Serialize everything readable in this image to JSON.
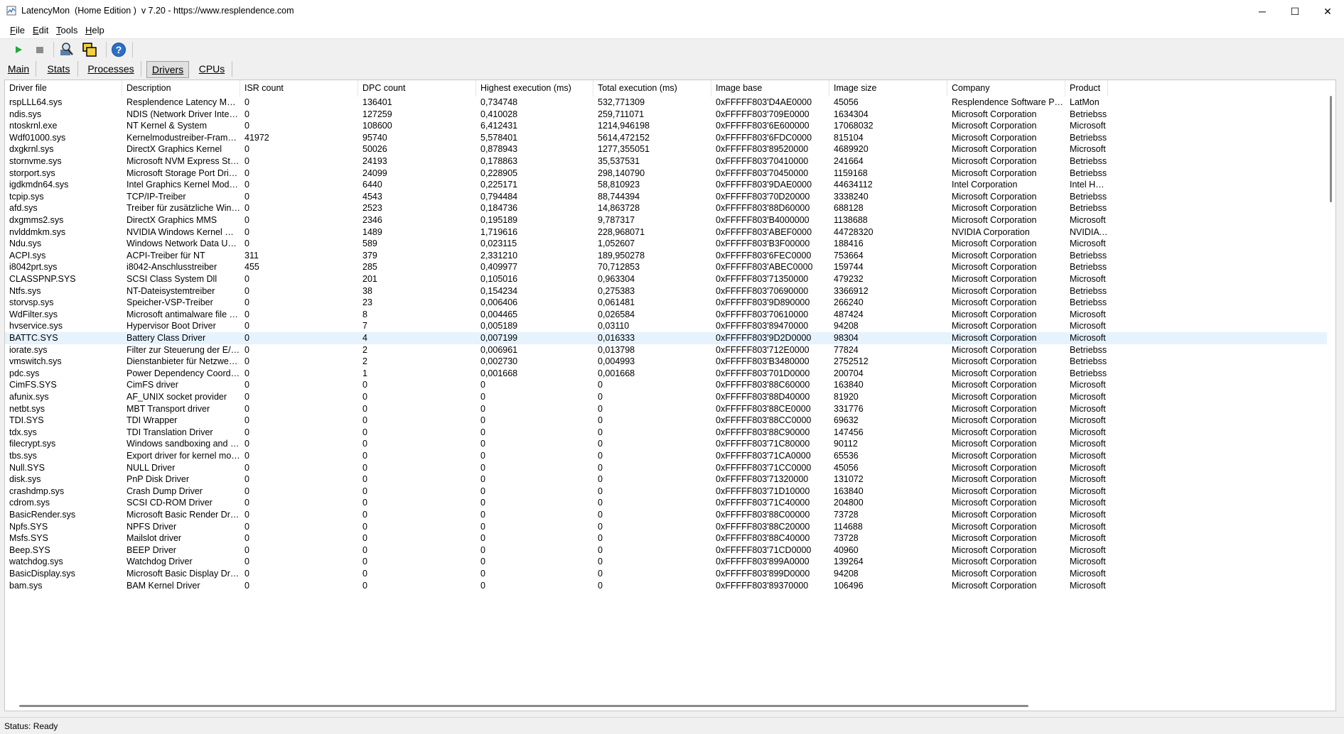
{
  "window": {
    "title": "LatencyMon  (Home Edition )  v 7.20 - https://www.resplendence.com",
    "minimize": "─",
    "maximize": "☐",
    "close": "✕"
  },
  "menu": [
    {
      "label": "File",
      "ul": "F",
      "rest": "ile"
    },
    {
      "label": "Edit",
      "ul": "E",
      "rest": "dit"
    },
    {
      "label": "Tools",
      "ul": "T",
      "rest": "ools"
    },
    {
      "label": "Help",
      "ul": "H",
      "rest": "elp"
    }
  ],
  "toolbar": {
    "icons": [
      "play-icon",
      "stop-icon",
      "driver-search-icon",
      "windows-icon",
      "help-icon"
    ],
    "colors": {
      "play": "#22a83a",
      "stop": "#8c8c8c",
      "help": "#2b6fc9"
    }
  },
  "tabs": [
    {
      "label": "Main"
    },
    {
      "label": "Stats"
    },
    {
      "label": "Processes"
    },
    {
      "label": "Drivers",
      "active": true
    },
    {
      "label": "CPUs"
    }
  ],
  "table": {
    "columns": [
      "Driver file",
      "Description",
      "ISR count",
      "DPC count",
      "Highest execution (ms)",
      "Total execution (ms)",
      "Image base",
      "Image size",
      "Company",
      "Product"
    ],
    "selected_row": 20,
    "rows": [
      [
        "rspLLL64.sys",
        "Resplendence Latency Monit...",
        "0",
        "136401",
        "0,734748",
        "532,771309",
        "0xFFFFF803'D4AE0000",
        "45056",
        "Resplendence Software Proje...",
        "LatMon"
      ],
      [
        "ndis.sys",
        "NDIS (Network Driver Interface...",
        "0",
        "127259",
        "0,410028",
        "259,711071",
        "0xFFFFF803'709E0000",
        "1634304",
        "Microsoft Corporation",
        "Betriebss"
      ],
      [
        "ntoskrnl.exe",
        "NT Kernel & System",
        "0",
        "108600",
        "6,412431",
        "1214,946198",
        "0xFFFFF803'6E600000",
        "17068032",
        "Microsoft Corporation",
        "Microsoft"
      ],
      [
        "Wdf01000.sys",
        "Kernelmodustreiber-Framewor...",
        "41972",
        "95740",
        "5,578401",
        "5614,472152",
        "0xFFFFF803'6FDC0000",
        "815104",
        "Microsoft Corporation",
        "Betriebss"
      ],
      [
        "dxgkrnl.sys",
        "DirectX Graphics Kernel",
        "0",
        "50026",
        "0,878943",
        "1277,355051",
        "0xFFFFF803'89520000",
        "4689920",
        "Microsoft Corporation",
        "Microsoft"
      ],
      [
        "stornvme.sys",
        "Microsoft NVM Express Storp...",
        "0",
        "24193",
        "0,178863",
        "35,537531",
        "0xFFFFF803'70410000",
        "241664",
        "Microsoft Corporation",
        "Betriebss"
      ],
      [
        "storport.sys",
        "Microsoft Storage Port Driver",
        "0",
        "24099",
        "0,228905",
        "298,140790",
        "0xFFFFF803'70450000",
        "1159168",
        "Microsoft Corporation",
        "Betriebss"
      ],
      [
        "igdkmdn64.sys",
        "Intel Graphics Kernel Mode N...",
        "0",
        "6440",
        "0,225171",
        "58,810923",
        "0xFFFFF803'9DAE0000",
        "44634112",
        "Intel Corporation",
        "Intel HD G"
      ],
      [
        "tcpip.sys",
        "TCP/IP-Treiber",
        "0",
        "4543",
        "0,794484",
        "88,744394",
        "0xFFFFF803'70D20000",
        "3338240",
        "Microsoft Corporation",
        "Betriebss"
      ],
      [
        "afd.sys",
        "Treiber für zusätzliche WinSo...",
        "0",
        "2523",
        "0,184736",
        "14,863728",
        "0xFFFFF803'88D60000",
        "688128",
        "Microsoft Corporation",
        "Betriebss"
      ],
      [
        "dxgmms2.sys",
        "DirectX Graphics MMS",
        "0",
        "2346",
        "0,195189",
        "9,787317",
        "0xFFFFF803'B4000000",
        "1138688",
        "Microsoft Corporation",
        "Microsoft"
      ],
      [
        "nvlddmkm.sys",
        "NVIDIA Windows Kernel Mod...",
        "0",
        "1489",
        "1,719616",
        "228,968071",
        "0xFFFFF803'ABEF0000",
        "44728320",
        "NVIDIA Corporation",
        "NVIDIA W"
      ],
      [
        "Ndu.sys",
        "Windows Network Data Usag...",
        "0",
        "589",
        "0,023115",
        "1,052607",
        "0xFFFFF803'B3F00000",
        "188416",
        "Microsoft Corporation",
        "Microsoft"
      ],
      [
        "ACPI.sys",
        "ACPI-Treiber für NT",
        "311",
        "379",
        "2,331210",
        "189,950278",
        "0xFFFFF803'6FEC0000",
        "753664",
        "Microsoft Corporation",
        "Betriebss"
      ],
      [
        "i8042prt.sys",
        "i8042-Anschlusstreiber",
        "455",
        "285",
        "0,409977",
        "70,712853",
        "0xFFFFF803'ABEC0000",
        "159744",
        "Microsoft Corporation",
        "Betriebss"
      ],
      [
        "CLASSPNP.SYS",
        "SCSI Class System Dll",
        "0",
        "201",
        "0,105016",
        "0,963304",
        "0xFFFFF803'71350000",
        "479232",
        "Microsoft Corporation",
        "Microsoft"
      ],
      [
        "Ntfs.sys",
        "NT-Dateisystemtreiber",
        "0",
        "38",
        "0,154234",
        "0,275383",
        "0xFFFFF803'70690000",
        "3366912",
        "Microsoft Corporation",
        "Betriebss"
      ],
      [
        "storvsp.sys",
        "Speicher-VSP-Treiber",
        "0",
        "23",
        "0,006406",
        "0,061481",
        "0xFFFFF803'9D890000",
        "266240",
        "Microsoft Corporation",
        "Betriebss"
      ],
      [
        "WdFilter.sys",
        "Microsoft antimalware file sys...",
        "0",
        "8",
        "0,004465",
        "0,026584",
        "0xFFFFF803'70610000",
        "487424",
        "Microsoft Corporation",
        "Microsoft"
      ],
      [
        "hvservice.sys",
        "Hypervisor Boot Driver",
        "0",
        "7",
        "0,005189",
        "0,03110",
        "0xFFFFF803'89470000",
        "94208",
        "Microsoft Corporation",
        "Microsoft"
      ],
      [
        "BATTC.SYS",
        "Battery Class Driver",
        "0",
        "4",
        "0,007199",
        "0,016333",
        "0xFFFFF803'9D2D0000",
        "98304",
        "Microsoft Corporation",
        "Microsoft"
      ],
      [
        "iorate.sys",
        "Filter zur Steuerung der E/A-...",
        "0",
        "2",
        "0,006961",
        "0,013798",
        "0xFFFFF803'712E0000",
        "77824",
        "Microsoft Corporation",
        "Betriebss"
      ],
      [
        "vmswitch.sys",
        "Dienstanbieter für Netzwerkvir...",
        "0",
        "2",
        "0,002730",
        "0,004993",
        "0xFFFFF803'B3480000",
        "2752512",
        "Microsoft Corporation",
        "Betriebss"
      ],
      [
        "pdc.sys",
        "Power Dependency Coordinat...",
        "0",
        "1",
        "0,001668",
        "0,001668",
        "0xFFFFF803'701D0000",
        "200704",
        "Microsoft Corporation",
        "Betriebss"
      ],
      [
        "CimFS.SYS",
        "CimFS driver",
        "0",
        "0",
        "0",
        "0",
        "0xFFFFF803'88C60000",
        "163840",
        "Microsoft Corporation",
        "Microsoft"
      ],
      [
        "afunix.sys",
        "AF_UNIX socket provider",
        "0",
        "0",
        "0",
        "0",
        "0xFFFFF803'88D40000",
        "81920",
        "Microsoft Corporation",
        "Microsoft"
      ],
      [
        "netbt.sys",
        "MBT Transport driver",
        "0",
        "0",
        "0",
        "0",
        "0xFFFFF803'88CE0000",
        "331776",
        "Microsoft Corporation",
        "Microsoft"
      ],
      [
        "TDI.SYS",
        "TDI Wrapper",
        "0",
        "0",
        "0",
        "0",
        "0xFFFFF803'88CC0000",
        "69632",
        "Microsoft Corporation",
        "Microsoft"
      ],
      [
        "tdx.sys",
        "TDI Translation Driver",
        "0",
        "0",
        "0",
        "0",
        "0xFFFFF803'88C90000",
        "147456",
        "Microsoft Corporation",
        "Microsoft"
      ],
      [
        "filecrypt.sys",
        "Windows sandboxing and enc...",
        "0",
        "0",
        "0",
        "0",
        "0xFFFFF803'71C80000",
        "90112",
        "Microsoft Corporation",
        "Microsoft"
      ],
      [
        "tbs.sys",
        "Export driver for kernel mode ...",
        "0",
        "0",
        "0",
        "0",
        "0xFFFFF803'71CA0000",
        "65536",
        "Microsoft Corporation",
        "Microsoft"
      ],
      [
        "Null.SYS",
        "NULL Driver",
        "0",
        "0",
        "0",
        "0",
        "0xFFFFF803'71CC0000",
        "45056",
        "Microsoft Corporation",
        "Microsoft"
      ],
      [
        "disk.sys",
        "PnP Disk Driver",
        "0",
        "0",
        "0",
        "0",
        "0xFFFFF803'71320000",
        "131072",
        "Microsoft Corporation",
        "Microsoft"
      ],
      [
        "crashdmp.sys",
        "Crash Dump Driver",
        "0",
        "0",
        "0",
        "0",
        "0xFFFFF803'71D10000",
        "163840",
        "Microsoft Corporation",
        "Microsoft"
      ],
      [
        "cdrom.sys",
        "SCSI CD-ROM Driver",
        "0",
        "0",
        "0",
        "0",
        "0xFFFFF803'71C40000",
        "204800",
        "Microsoft Corporation",
        "Microsoft"
      ],
      [
        "BasicRender.sys",
        "Microsoft Basic Render Driver",
        "0",
        "0",
        "0",
        "0",
        "0xFFFFF803'88C00000",
        "73728",
        "Microsoft Corporation",
        "Microsoft"
      ],
      [
        "Npfs.SYS",
        "NPFS Driver",
        "0",
        "0",
        "0",
        "0",
        "0xFFFFF803'88C20000",
        "114688",
        "Microsoft Corporation",
        "Microsoft"
      ],
      [
        "Msfs.SYS",
        "Mailslot driver",
        "0",
        "0",
        "0",
        "0",
        "0xFFFFF803'88C40000",
        "73728",
        "Microsoft Corporation",
        "Microsoft"
      ],
      [
        "Beep.SYS",
        "BEEP Driver",
        "0",
        "0",
        "0",
        "0",
        "0xFFFFF803'71CD0000",
        "40960",
        "Microsoft Corporation",
        "Microsoft"
      ],
      [
        "watchdog.sys",
        "Watchdog Driver",
        "0",
        "0",
        "0",
        "0",
        "0xFFFFF803'899A0000",
        "139264",
        "Microsoft Corporation",
        "Microsoft"
      ],
      [
        "BasicDisplay.sys",
        "Microsoft Basic Display Driver",
        "0",
        "0",
        "0",
        "0",
        "0xFFFFF803'899D0000",
        "94208",
        "Microsoft Corporation",
        "Microsoft"
      ],
      [
        "bam.sys",
        "BAM Kernel Driver",
        "0",
        "0",
        "0",
        "0",
        "0xFFFFF803'89370000",
        "106496",
        "Microsoft Corporation",
        "Microsoft"
      ]
    ]
  },
  "status": {
    "text": "Status: Ready"
  }
}
